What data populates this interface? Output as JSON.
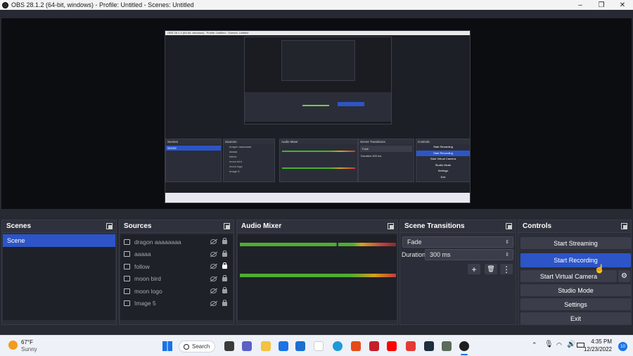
{
  "window": {
    "title": "OBS 28.1.2 (64-bit, windows) - Profile: Untitled - Scenes: Untitled",
    "minimize": "–",
    "maximize": "❐",
    "close": "✕"
  },
  "preview_inner": {
    "title": "OBS 28.1.2 (64-bit, windows) - Profile: Untitled - Scenes: Untitled",
    "panels": [
      "Scenes",
      "Sources",
      "Audio Mixer",
      "Scene Transitions",
      "Controls"
    ],
    "scene": "Scene",
    "sources": [
      "dragon aaaaaaaa",
      "aaaaa",
      "follow",
      "moon bird",
      "moon logo",
      "Image 5"
    ],
    "transition": "Fade",
    "duration_label": "Duration",
    "duration_value": "300 ms",
    "controls": [
      "Start Streaming",
      "Start Recording",
      "Start Virtual Camera",
      "Studio Mode",
      "Settings",
      "Exit"
    ]
  },
  "scenes": {
    "header": "Scenes",
    "items": [
      "Scene"
    ]
  },
  "sources": {
    "header": "Sources",
    "items": [
      {
        "name": "dragon aaaaaaaa",
        "locked": false
      },
      {
        "name": "aaaaa",
        "locked": false
      },
      {
        "name": "follow",
        "locked": true
      },
      {
        "name": "moon bird",
        "locked": false
      },
      {
        "name": "moon logo",
        "locked": false
      },
      {
        "name": "Image 5",
        "locked": false
      }
    ]
  },
  "audio_mixer": {
    "header": "Audio Mixer"
  },
  "transitions": {
    "header": "Scene Transitions",
    "selected": "Fade",
    "duration_label": "Duration",
    "duration_value": "300 ms",
    "add": "+",
    "remove": "🗑",
    "more": "⋮"
  },
  "controls": {
    "header": "Controls",
    "start_streaming": "Start Streaming",
    "start_recording": "Start Recording",
    "start_virtual_camera": "Start Virtual Camera",
    "studio_mode": "Studio Mode",
    "settings": "Settings",
    "exit": "Exit"
  },
  "taskbar": {
    "weather_temp": "67°F",
    "weather_desc": "Sunny",
    "search": "Search",
    "time": "4:35 PM",
    "date": "12/23/2022",
    "notifications": "10"
  },
  "colors": {
    "accent": "#2d55c8",
    "panel": "#2b2e38",
    "background": "#272a33"
  }
}
